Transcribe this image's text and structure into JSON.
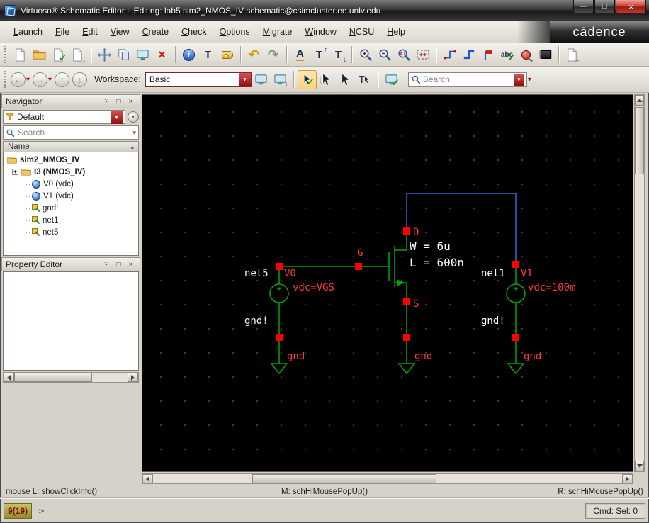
{
  "window": {
    "title": "Virtuoso® Schematic Editor L Editing: lab5 sim2_NMOS_IV schematic@csimcluster.ee.unlv.edu"
  },
  "brand": {
    "logo": "cādence"
  },
  "menu": {
    "items": [
      "Launch",
      "File",
      "Edit",
      "View",
      "Create",
      "Check",
      "Options",
      "Migrate",
      "Window",
      "NCSU",
      "Help"
    ]
  },
  "toolbar2": {
    "workspace_label": "Workspace:",
    "workspace_value": "Basic",
    "search_placeholder": "Search"
  },
  "navigator": {
    "title": "Navigator",
    "filter_value": "Default",
    "search_placeholder": "Search",
    "column_header": "Name",
    "tree": [
      {
        "label": "sim2_NMOS_IV"
      },
      {
        "label": "I3 (NMOS_IV)"
      },
      {
        "label": "V0 (vdc)"
      },
      {
        "label": "V1 (vdc)"
      },
      {
        "label": "gnd!"
      },
      {
        "label": "net1"
      },
      {
        "label": "net5"
      }
    ]
  },
  "property_editor": {
    "title": "Property Editor"
  },
  "schematic": {
    "terminals": {
      "drain": "D",
      "gate": "G",
      "source": "S"
    },
    "device": {
      "width": "W = 6u",
      "length": "L = 600n"
    },
    "nets": {
      "left": "net5",
      "right": "net1",
      "gnd_left": "gnd!",
      "gnd_right": "gnd!"
    },
    "sources": {
      "v0_name": "V0",
      "v0_value": "vdc=VGS",
      "v1_name": "V1",
      "v1_value": "vdc=100m"
    },
    "gnd_pins": {
      "left": "gnd",
      "mid": "gnd",
      "right": "gnd"
    },
    "colors": {
      "background": "#000000",
      "wire": "#00a800",
      "bus": "#4169e1",
      "pin": "#ff0000",
      "label_red": "#ff3838",
      "label_white": "#ffffff"
    }
  },
  "statusbar": {
    "left": "mouse L: showClickInfo()",
    "middle": "M: schHiMousePopUp()",
    "right": "R: schHiMousePopUp()"
  },
  "cmdbar": {
    "counter": "9(19)",
    "prompt": ">",
    "selection": "Cmd: Sel: 0"
  },
  "icons": {
    "minimize": "—",
    "maximize": "□",
    "close": "×",
    "help": "?",
    "float": "□",
    "panel_close": "×",
    "caret": "▾",
    "sort": "▴",
    "plus": "+",
    "minus": "−",
    "cross": "×",
    "check": "✓",
    "info": "i",
    "letter_t": "T",
    "letter_a": "A",
    "abc": "abc",
    "undo": "↶",
    "redo": "↷",
    "left": "←",
    "right": "→",
    "up": "↑",
    "down": "↓"
  }
}
